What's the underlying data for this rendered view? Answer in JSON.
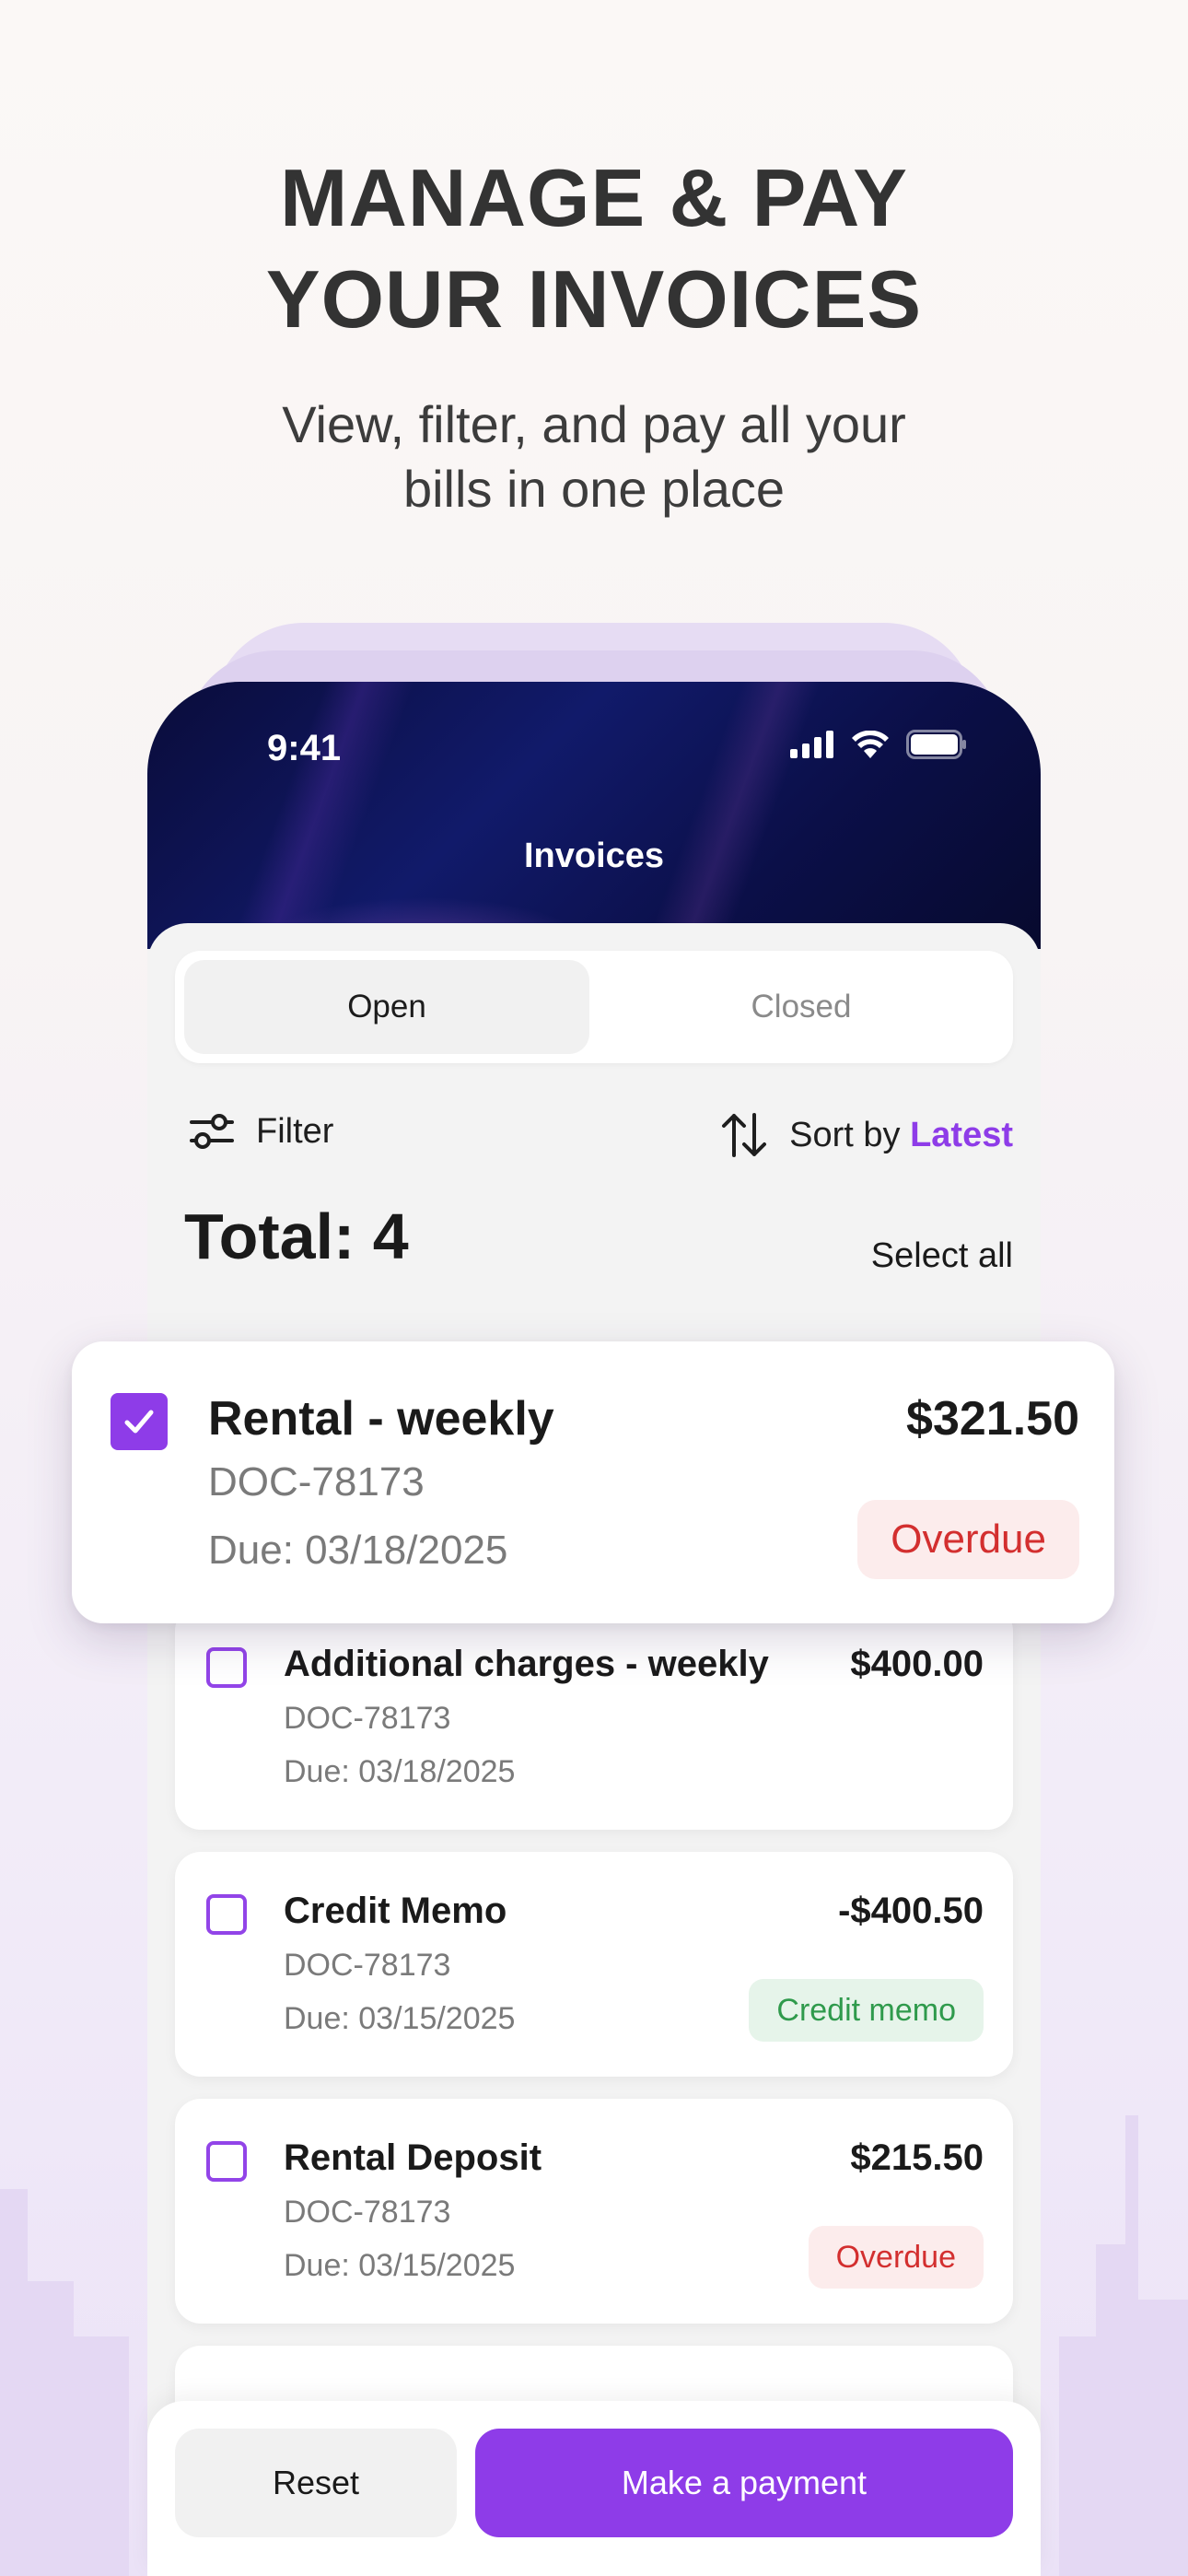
{
  "hero": {
    "headline_line1": "MANAGE & PAY",
    "headline_line2": "YOUR INVOICES",
    "subline_line1": "View, filter, and pay all your",
    "subline_line2": "bills in one place"
  },
  "status_bar": {
    "time": "9:41"
  },
  "header": {
    "title": "Invoices"
  },
  "tabs": {
    "open": "Open",
    "closed": "Closed",
    "selected": "Open"
  },
  "toolbar": {
    "filter_label": "Filter",
    "sort_prefix": "Sort by",
    "sort_value": "Latest"
  },
  "summary": {
    "total_label": "Total: 4",
    "select_all": "Select all"
  },
  "highlighted_invoice": {
    "title": "Rental - weekly",
    "doc": "DOC-78173",
    "due": "Due: 03/18/2025",
    "amount": "$321.50",
    "status": "Overdue",
    "checked": true
  },
  "invoices": [
    {
      "title": "Additional charges - weekly",
      "doc": "DOC-78173",
      "due": "Due: 03/18/2025",
      "amount": "$400.00",
      "status": "",
      "checked": false
    },
    {
      "title": "Credit Memo",
      "doc": "DOC-78173",
      "due": "Due: 03/15/2025",
      "amount": "-$400.50",
      "status": "Credit memo",
      "checked": false
    },
    {
      "title": "Rental Deposit",
      "doc": "DOC-78173",
      "due": "Due: 03/15/2025",
      "amount": "$215.50",
      "status": "Overdue",
      "checked": false
    }
  ],
  "actions": {
    "reset": "Reset",
    "pay": "Make a payment"
  },
  "colors": {
    "accent": "#8e3ce8",
    "overdue": "#d32f2f",
    "credit": "#2f9a4c",
    "header_bg": "#0b0f48"
  },
  "icons": [
    "signal-icon",
    "wifi-icon",
    "battery-icon",
    "filter-icon",
    "sort-icon",
    "checkbox-checked-icon",
    "checkbox-icon"
  ]
}
